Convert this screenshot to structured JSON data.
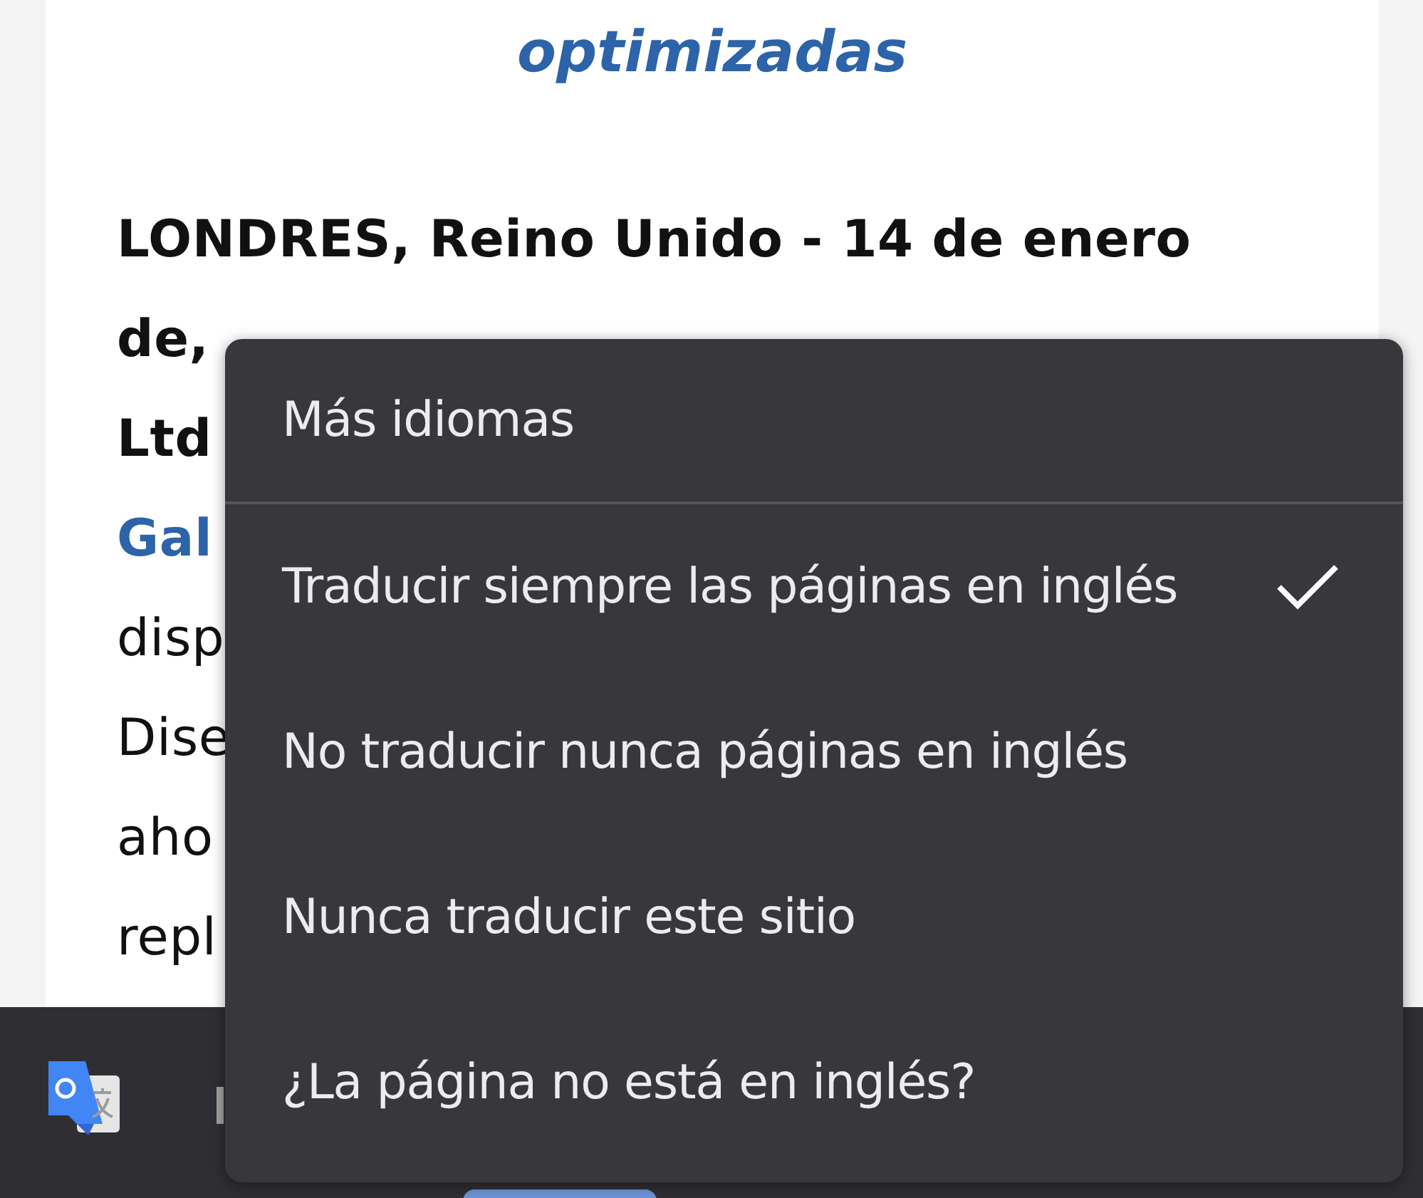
{
  "article": {
    "heading": "optimizadas",
    "lines": [
      {
        "text": "LONDRES, Reino Unido - 14 de enero",
        "kind": "bold"
      },
      {
        "text": "de,",
        "kind": "bold"
      },
      {
        "text": "Ltd",
        "kind": "bold"
      },
      {
        "text": "Gal",
        "kind": "link"
      },
      {
        "text": "disp",
        "kind": "plain"
      },
      {
        "text": "Dise",
        "kind": "plain"
      },
      {
        "text": "aho",
        "kind": "plain"
      },
      {
        "text": "repl",
        "kind": "plain"
      }
    ]
  },
  "menu": {
    "items": [
      {
        "kind": "link",
        "label": "Más idiomas",
        "checked": false
      },
      {
        "kind": "option",
        "label": "Traducir siempre las páginas en inglés",
        "checked": true
      },
      {
        "kind": "option",
        "label": "No traducir nunca páginas en inglés",
        "checked": false
      },
      {
        "kind": "option",
        "label": "Nunca traducir este sitio",
        "checked": false
      },
      {
        "kind": "option",
        "label": "¿La página no está en inglés?",
        "checked": false
      }
    ]
  }
}
